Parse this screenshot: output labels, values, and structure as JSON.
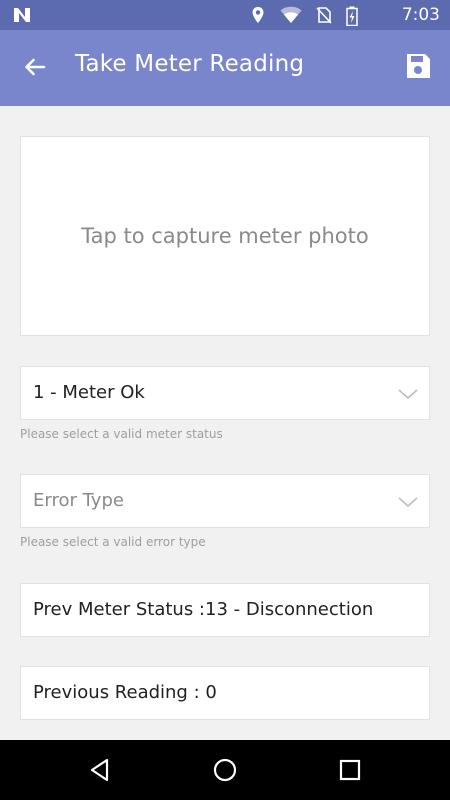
{
  "status_bar": {
    "time": "7:03",
    "icons": [
      "notification-n-icon",
      "location-icon",
      "wifi-icon",
      "no-sim-icon",
      "battery-charging-icon"
    ]
  },
  "app_bar": {
    "title": "Take Meter Reading",
    "back_icon": "arrow-back-icon",
    "save_icon": "save-icon"
  },
  "photo": {
    "label": "Tap to capture meter photo"
  },
  "meter_status": {
    "value": "1 - Meter Ok",
    "helper": "Please select a valid meter status"
  },
  "error_type": {
    "placeholder": "Error Type",
    "helper": "Please select a valid error type"
  },
  "prev_status": {
    "text": "Prev Meter Status :13 - Disconnection"
  },
  "previous_reading": {
    "text": "Previous Reading : 0"
  },
  "colors": {
    "status_bar": "#5c6bb0",
    "app_bar": "#7986cb",
    "background": "#f1f1f1"
  }
}
